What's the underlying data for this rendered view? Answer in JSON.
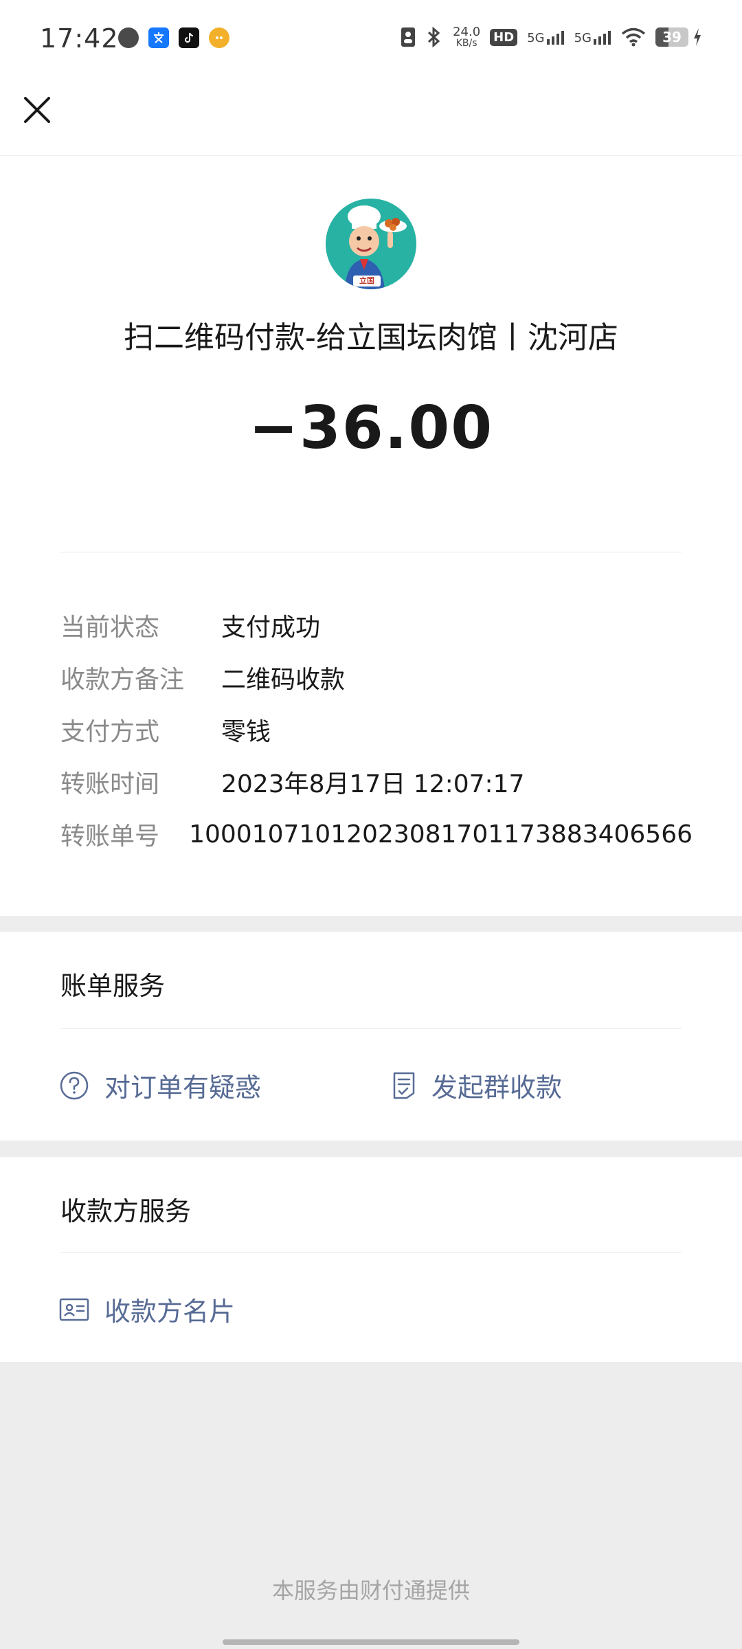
{
  "status_bar": {
    "time": "17:42",
    "net_speed_value": "24.0",
    "net_speed_unit": "KB/s",
    "hd_label": "HD",
    "signal1": "5G",
    "signal2": "5G",
    "battery_percent": "39",
    "battery_level": 0.39
  },
  "nav": {
    "close_icon": "close-icon"
  },
  "transaction": {
    "merchant_title": "扫二维码付款-给立国坛肉馆丨沈河店",
    "amount": "−36.00",
    "avatar_text": "立国",
    "details": [
      {
        "label": "当前状态",
        "value": "支付成功"
      },
      {
        "label": "收款方备注",
        "value": "二维码收款"
      },
      {
        "label": "支付方式",
        "value": "零钱"
      },
      {
        "label": "转账时间",
        "value": "2023年8月17日 12:07:17"
      },
      {
        "label": "转账单号",
        "value": "10001071012023081701173883406566"
      }
    ]
  },
  "bill_services": {
    "title": "账单服务",
    "question_label": "对订单有疑惑",
    "group_collect_label": "发起群收款"
  },
  "payee_services": {
    "title": "收款方服务",
    "card_label": "收款方名片"
  },
  "footer": {
    "text": "本服务由财付通提供"
  },
  "colors": {
    "link": "#576b95",
    "avatar_bg": "#27b2a4"
  }
}
